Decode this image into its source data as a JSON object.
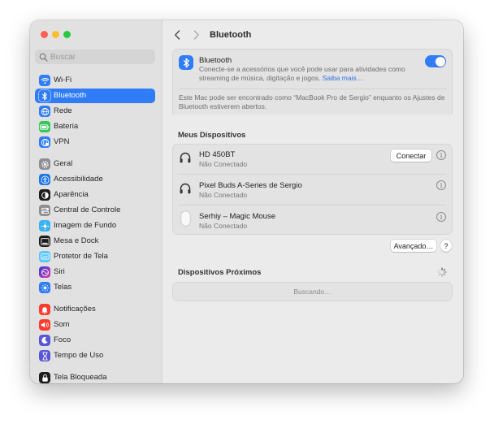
{
  "sidebar": {
    "search_placeholder": "Buscar",
    "items": [
      {
        "label": "Wi-Fi",
        "icon": "wifi-icon",
        "color": "#2f7cf6"
      },
      {
        "label": "Bluetooth",
        "icon": "bluetooth-icon",
        "color": "#2f7cf6",
        "selected": true
      },
      {
        "label": "Rede",
        "icon": "globe-icon",
        "color": "#2f7cf6"
      },
      {
        "label": "Bateria",
        "icon": "battery-icon",
        "color": "#34c759"
      },
      {
        "label": "VPN",
        "icon": "vpn-icon",
        "color": "#2f7cf6"
      },
      {
        "label": "Geral",
        "icon": "gear-icon",
        "color": "#8e8e93"
      },
      {
        "label": "Acessibilidade",
        "icon": "accessibility-icon",
        "color": "#1b75e8"
      },
      {
        "label": "Aparência",
        "icon": "appearance-icon",
        "color": "#1c1c1e"
      },
      {
        "label": "Central de Controle",
        "icon": "control-center-icon",
        "color": "#8e8e93"
      },
      {
        "label": "Imagem de Fundo",
        "icon": "wallpaper-icon",
        "color": "#38b4f0"
      },
      {
        "label": "Mesa e Dock",
        "icon": "desktop-dock-icon",
        "color": "#1c1c1e"
      },
      {
        "label": "Protetor de Tela",
        "icon": "screensaver-icon",
        "color": "#5ac8fa"
      },
      {
        "label": "Siri",
        "icon": "siri-icon",
        "color": "#b03cd8"
      },
      {
        "label": "Telas",
        "icon": "displays-icon",
        "color": "#2f7cf6"
      },
      {
        "label": "Notificações",
        "icon": "notifications-icon",
        "color": "#ff3b30"
      },
      {
        "label": "Som",
        "icon": "sound-icon",
        "color": "#ff3b30"
      },
      {
        "label": "Foco",
        "icon": "focus-moon-icon",
        "color": "#5856d6"
      },
      {
        "label": "Tempo de Uso",
        "icon": "hourglass-icon",
        "color": "#5856d6"
      },
      {
        "label": "Tela Bloqueada",
        "icon": "lock-screen-icon",
        "color": "#1c1c1e"
      }
    ]
  },
  "header": {
    "title": "Bluetooth"
  },
  "bluetooth": {
    "title": "Bluetooth",
    "description_line1": "Conecte-se a acessórios que você pode usar para atividades como",
    "description_line2": "streaming de música, digitação e jogos.",
    "learn_more": "Saiba mais…",
    "enabled": true,
    "discoverable_line1": "Este Mac pode ser encontrado como “MacBook Pro de Sergio” enquanto os Ajustes de",
    "discoverable_line2": "Bluetooth estiverem abertos."
  },
  "my_devices": {
    "title": "Meus Dispositivos",
    "devices": [
      {
        "name": "HD 450BT",
        "status": "Não Conectado",
        "icon": "headphones-icon",
        "action": "Conectar"
      },
      {
        "name": "Pixel Buds A-Series de Sergio",
        "status": "Não Conectado",
        "icon": "headphones-icon",
        "action": ""
      },
      {
        "name": "Serhiy – Magic Mouse",
        "status": "Não Conectado",
        "icon": "mouse-icon",
        "action": ""
      }
    ],
    "info_glyph": "i"
  },
  "advanced_button": "Avançado…",
  "help_button": "?",
  "nearby": {
    "title": "Dispositivos Próximos",
    "searching": "Buscando…"
  },
  "colors": {
    "accent": "#2f7cf6",
    "toggle_on": "#2f7cf6"
  }
}
